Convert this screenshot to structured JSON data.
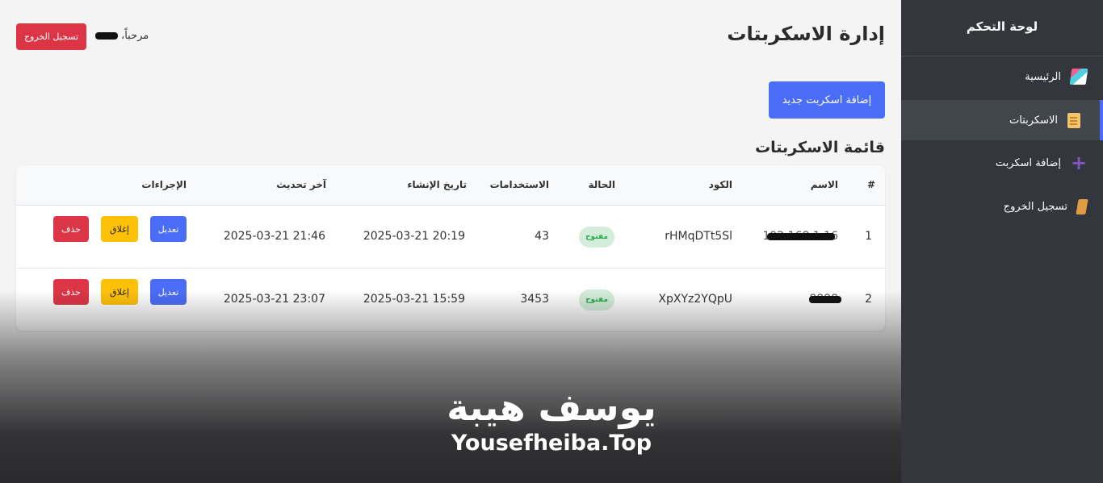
{
  "sidebar": {
    "title": "لوحة التحكم",
    "items": [
      {
        "label": "الرئيسية",
        "icon": "home-icon"
      },
      {
        "label": "الاسكربتات",
        "icon": "scripts-icon",
        "active": true
      },
      {
        "label": "إضافة اسكربت",
        "icon": "plus-icon"
      },
      {
        "label": "تسجيل الخروج",
        "icon": "logout-icon"
      }
    ]
  },
  "header": {
    "title": "إدارة الاسكربتات",
    "greeting": "مرحباً،",
    "logout_label": "تسجيل الخروج"
  },
  "main": {
    "add_button_label": "إضافة اسكربت جديد",
    "section_title": "قائمة الاسكربتات"
  },
  "table": {
    "headers": {
      "index": "#",
      "name": "الاسم",
      "code": "الكود",
      "status": "الحالة",
      "uses": "الاستخدامات",
      "created": "تاريخ الإنشاء",
      "updated": "آخر تحديث",
      "actions": "الإجراءات"
    },
    "rows": [
      {
        "index": "1",
        "name": "192.168.1.16",
        "code": "rHMqDTt5Sl",
        "status": "مفتوح",
        "uses": "43",
        "created": "2025-03-21 20:19",
        "updated": "2025-03-21 21:46"
      },
      {
        "index": "2",
        "name": "8888",
        "code": "XpXYz2YQpU",
        "status": "مفتوح",
        "uses": "3453",
        "created": "2025-03-21 15:59",
        "updated": "2025-03-21 23:07"
      }
    ],
    "actions": {
      "edit": "تعديل",
      "close": "إغلاق",
      "delete": "حذف"
    }
  },
  "watermark": {
    "arabic": "يوسف هيبة",
    "english": "Yousefheiba.Top"
  },
  "colors": {
    "accent": "#4a6cf7",
    "danger": "#dc3545",
    "warning": "#ffc107",
    "success": "#28a745",
    "sidebar": "#33373d"
  }
}
